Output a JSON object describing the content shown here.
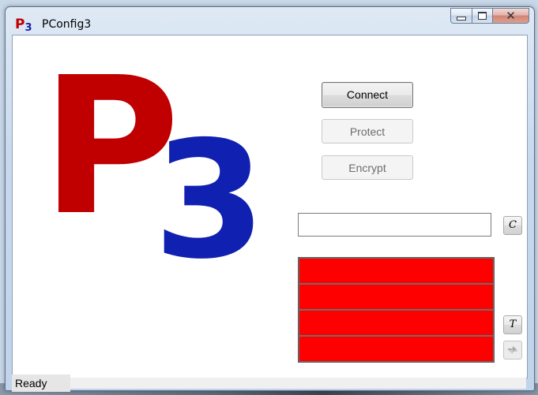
{
  "window": {
    "title": "PConfig3",
    "icon": {
      "name": "p3-app-icon",
      "letter": "P",
      "digit": "3"
    }
  },
  "logo": {
    "letter": "P",
    "digit": "3",
    "letter_color": "#c00000",
    "digit_color": "#1020b0"
  },
  "buttons": {
    "connect": "Connect",
    "protect": "Protect",
    "encrypt": "Encrypt",
    "clear": "C",
    "test": "T"
  },
  "input": {
    "value": ""
  },
  "indicators": [
    {
      "color": "#ff0000"
    },
    {
      "color": "#ff0000"
    },
    {
      "color": "#ff0000"
    },
    {
      "color": "#ff0000"
    }
  ],
  "status": {
    "text": "Ready"
  },
  "colors": {
    "indicator_red": "#ff0000"
  }
}
